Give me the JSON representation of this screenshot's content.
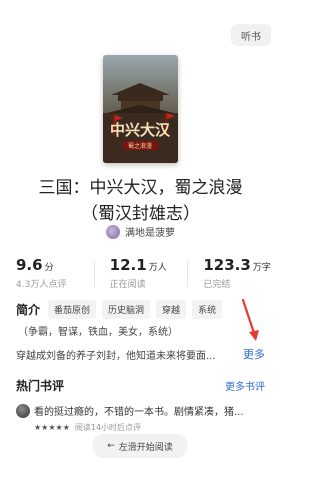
{
  "header": {
    "listen_label": "听书"
  },
  "cover": {
    "title_text": "中兴大汉",
    "subtitle_text": "蜀之浪漫"
  },
  "book": {
    "title_line1": "三国：中兴大汉，蜀之浪漫",
    "title_line2": "（蜀汉封雄志）",
    "author": "满地是菠萝"
  },
  "stats": [
    {
      "value": "9.6",
      "unit": "分",
      "sub": "4.3万人点评"
    },
    {
      "value": "12.1",
      "unit": "万人",
      "sub": "正在阅读"
    },
    {
      "value": "123.3",
      "unit": "万字",
      "sub": "已完结"
    }
  ],
  "intro": {
    "label": "简介",
    "tags": [
      "番茄原创",
      "历史脑洞",
      "穿越",
      "系统"
    ],
    "keywords": "（争霸，智谋，铁血，美女，系统）",
    "text": "穿越成刘备的养子刘封，他知道未来将要面...",
    "more_label": "更多"
  },
  "reviews": {
    "title": "热门书评",
    "more_label": "更多书评",
    "items": [
      {
        "text": "看的挺过瘾的，不错的一本书。剧情紧凑，猪...",
        "stars": "★★★★★",
        "meta": "阅读14小时后点评"
      }
    ]
  },
  "swipe": {
    "label": "左滑开始阅读",
    "arrow": "←"
  },
  "colors": {
    "link": "#2f6bd6",
    "annotation_arrow": "#e53935"
  }
}
